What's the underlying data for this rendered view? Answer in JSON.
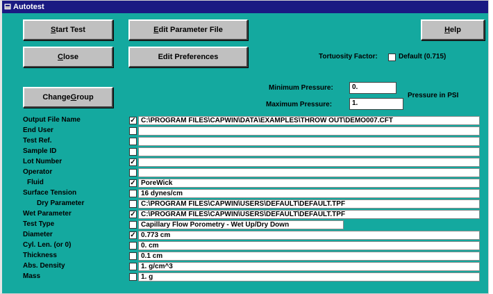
{
  "window": {
    "title": "Autotest"
  },
  "buttons": {
    "start_test": {
      "pre": "",
      "u": "S",
      "post": "tart Test"
    },
    "edit_param": {
      "pre": "",
      "u": "E",
      "post": "dit Parameter File"
    },
    "help": {
      "pre": "",
      "u": "H",
      "post": "elp"
    },
    "close": {
      "pre": "",
      "u": "C",
      "post": "lose"
    },
    "edit_prefs": {
      "pre": "Edit Preferences",
      "u": "",
      "post": ""
    },
    "change_group": {
      "pre": "Change ",
      "u": "G",
      "post": "roup"
    }
  },
  "tortuosity": {
    "label": "Tortuosity Factor:",
    "default_label": "Default (0.715)",
    "checked": ""
  },
  "pressure": {
    "min_label": "Minimum Pressure:",
    "min_value": "0.",
    "max_label": "Maximum Pressure:",
    "max_value": "1.",
    "unit_label": "Pressure in PSI"
  },
  "rows": [
    {
      "label": "Output File Name",
      "check": "✓",
      "value": "C:\\PROGRAM FILES\\CAPWIN\\DATA\\EXAMPLES\\THROW OUT\\DEMO007.CFT"
    },
    {
      "label": "End User",
      "check": "",
      "value": ""
    },
    {
      "label": "Test Ref.",
      "check": "",
      "value": ""
    },
    {
      "label": "Sample ID",
      "check": "",
      "value": ""
    },
    {
      "label": "Lot Number",
      "check": "✓",
      "value": ""
    },
    {
      "label": "Operator",
      "check": "",
      "value": ""
    },
    {
      "label": "Fluid",
      "check": "✓",
      "value": "PoreWick"
    },
    {
      "label": "Surface Tension",
      "check": "",
      "value": " 16 dynes/cm"
    },
    {
      "label": "Dry Parameter",
      "check": "",
      "value": "C:\\PROGRAM FILES\\CAPWIN\\USERS\\DEFAULT\\DEFAULT.TPF"
    },
    {
      "label": "Wet Parameter",
      "check": "✓",
      "value": "C:\\PROGRAM FILES\\CAPWIN\\USERS\\DEFAULT\\DEFAULT.TPF"
    },
    {
      "label": "Test Type",
      "check": "",
      "value": "Capillary Flow Porometry - Wet Up/Dry Down"
    },
    {
      "label": "Diameter",
      "check": "✓",
      "value": "0.773 cm"
    },
    {
      "label": "Cyl. Len. (or 0)",
      "check": "",
      "value": "0. cm"
    },
    {
      "label": "Thickness",
      "check": "",
      "value": "0.1 cm"
    },
    {
      "label": "Abs. Density",
      "check": "",
      "value": "1. g/cm^3"
    },
    {
      "label": "Mass",
      "check": "",
      "value": "1. g"
    }
  ]
}
